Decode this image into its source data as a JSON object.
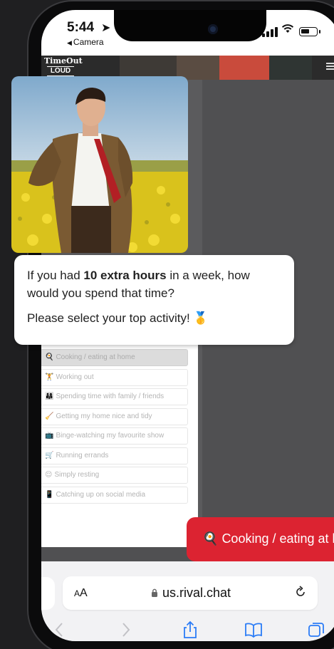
{
  "status_bar": {
    "time": "5:44",
    "location_glyph": "➤",
    "back_label": "Camera"
  },
  "site_header": {
    "logo_line1": "TimeOut",
    "logo_line2": "LOUD"
  },
  "media": {
    "kind": "photo",
    "subject": "man in a brown jacket and red tie standing in a yellow flower field"
  },
  "question": {
    "prefix": "If you had ",
    "highlight": "10 extra hours",
    "suffix": " in a week, how would you spend that time?",
    "prompt": "Please select your top activity!",
    "prompt_emoji": "🥇"
  },
  "options": [
    {
      "emoji": "🍳",
      "label": "Cooking / eating at home",
      "selected": true
    },
    {
      "emoji": "🏋",
      "label": "Working out",
      "selected": false
    },
    {
      "emoji": "👨‍👩‍👧",
      "label": "Spending time with family / friends",
      "selected": false
    },
    {
      "emoji": "🧹",
      "label": "Getting my home nice and tidy",
      "selected": false
    },
    {
      "emoji": "📺",
      "label": "Binge-watching my favourite show",
      "selected": false
    },
    {
      "emoji": "🛒",
      "label": "Running errands",
      "selected": false
    },
    {
      "emoji": "😌",
      "label": "Simply resting",
      "selected": false
    },
    {
      "emoji": "📱",
      "label": "Catching up on social media",
      "selected": false
    }
  ],
  "selected_answer": {
    "emoji": "🍳",
    "label": "Cooking / eating at home"
  },
  "safari": {
    "aa_small": "A",
    "aa_large": "A",
    "url": "us.rival.chat"
  },
  "colors": {
    "accent_red": "#dc2331",
    "page_bg": "#1f1f21",
    "safari_bar": "#f2f2f4",
    "toolbar_icon_blue": "#2b7cf6"
  },
  "icons": {
    "address": [
      "lock-icon",
      "reload-icon"
    ],
    "toolbar": [
      "back-chevron-icon",
      "forward-chevron-icon",
      "share-icon",
      "bookmarks-icon",
      "tabs-icon"
    ]
  }
}
